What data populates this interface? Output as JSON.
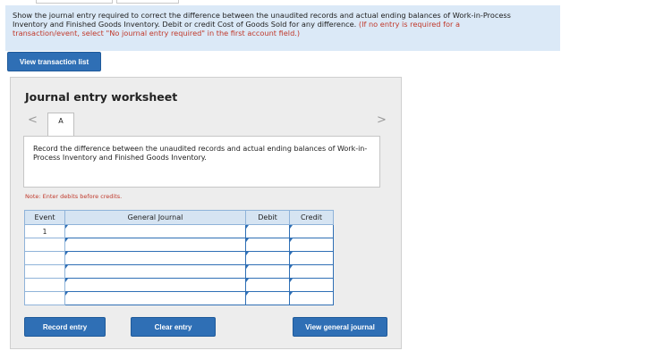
{
  "instructions": {
    "line1": "Show the journal entry required to correct the difference between the unaudited records and actual ending balances of Work-in-Process",
    "line2": "Inventory and Finished Goods Inventory. Debit or credit Cost of Goods Sold for any difference.",
    "hint_a": "(If no entry is required for a",
    "hint_b": "transaction/event, select \"No journal entry required\" in the first account field.)"
  },
  "view_transaction_list_label": "View transaction list",
  "worksheet": {
    "title": "Journal entry worksheet",
    "prev_arrow": "<",
    "next_arrow": ">",
    "active_tab": "A",
    "description": "Record the difference between the unaudited records and actual ending balances of Work-in-Process Inventory and Finished Goods Inventory.",
    "note": "Note: Enter debits before credits.",
    "columns": {
      "event": "Event",
      "general_journal": "General Journal",
      "debit": "Debit",
      "credit": "Credit"
    },
    "rows": [
      {
        "event": "1",
        "account": "",
        "debit": "",
        "credit": ""
      },
      {
        "event": "",
        "account": "",
        "debit": "",
        "credit": ""
      },
      {
        "event": "",
        "account": "",
        "debit": "",
        "credit": ""
      },
      {
        "event": "",
        "account": "",
        "debit": "",
        "credit": ""
      },
      {
        "event": "",
        "account": "",
        "debit": "",
        "credit": ""
      },
      {
        "event": "",
        "account": "",
        "debit": "",
        "credit": ""
      }
    ],
    "buttons": {
      "record": "Record entry",
      "clear": "Clear entry",
      "view_general_journal": "View general journal"
    }
  },
  "colors": {
    "accent": "#2f6fb5",
    "instructions_bg": "#dbe9f7",
    "hint_text": "#c0392b"
  }
}
